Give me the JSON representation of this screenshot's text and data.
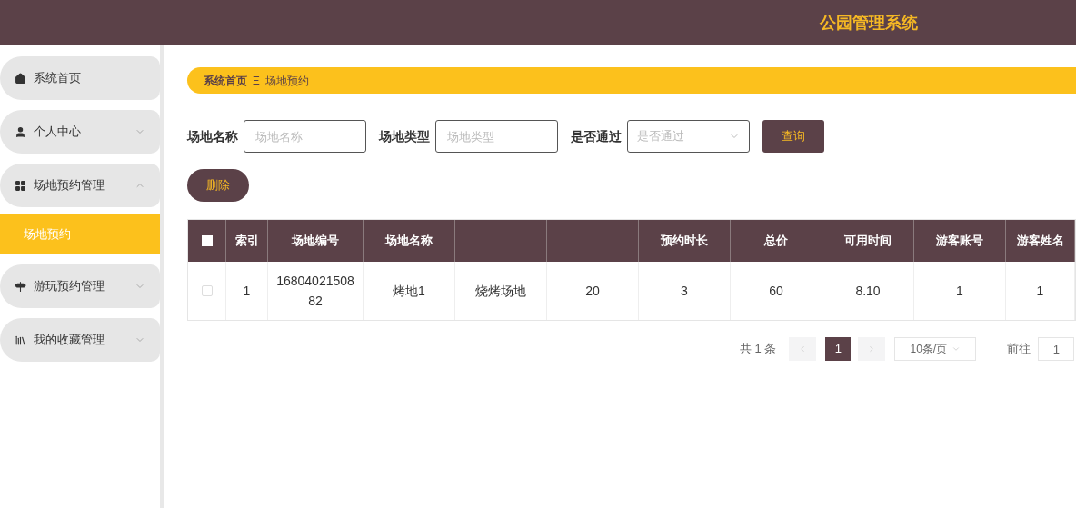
{
  "header": {
    "title": "公园管理系统"
  },
  "sidebar": {
    "items": [
      {
        "label": "系统首页"
      },
      {
        "label": "个人中心",
        "expandable": true,
        "expanded": false
      },
      {
        "label": "场地预约管理",
        "expandable": true,
        "expanded": true,
        "children": [
          {
            "label": "场地预约",
            "selected": true
          }
        ]
      },
      {
        "label": "游玩预约管理",
        "expandable": true,
        "expanded": false
      },
      {
        "label": "我的收藏管理",
        "expandable": true,
        "expanded": false
      }
    ]
  },
  "breadcrumb": {
    "home": "系统首页",
    "separator": "Ξ",
    "current": "场地预约"
  },
  "search": {
    "fields": [
      {
        "kind": "input",
        "label": "场地名称",
        "placeholder": "场地名称"
      },
      {
        "kind": "input",
        "label": "场地类型",
        "placeholder": "场地类型"
      },
      {
        "kind": "select",
        "label": "是否通过",
        "placeholder": "是否通过"
      }
    ],
    "button": "查询"
  },
  "delete_button": "删除",
  "table": {
    "all_checked": false,
    "columns": [
      {
        "label": "索引"
      },
      {
        "label": "场地编号"
      },
      {
        "label": "场地名称"
      },
      {},
      {},
      {
        "label": "预约时长"
      },
      {
        "label": "总价"
      },
      {
        "label": "可用时间"
      },
      {
        "label": "游客账号"
      },
      {
        "label": "游客姓名"
      }
    ],
    "rows": [
      {
        "checked": false,
        "cells": [
          "1",
          "1680402150882",
          "烤地1",
          "烧烤场地",
          "20",
          "3",
          "60",
          "8.10",
          "1",
          "1"
        ]
      }
    ]
  },
  "pagination": {
    "total": "共 1 条",
    "pages": [
      {
        "label": "1",
        "selected": true
      }
    ],
    "page_size": "10条/页",
    "goto_label": "前往",
    "goto_value": "1"
  }
}
